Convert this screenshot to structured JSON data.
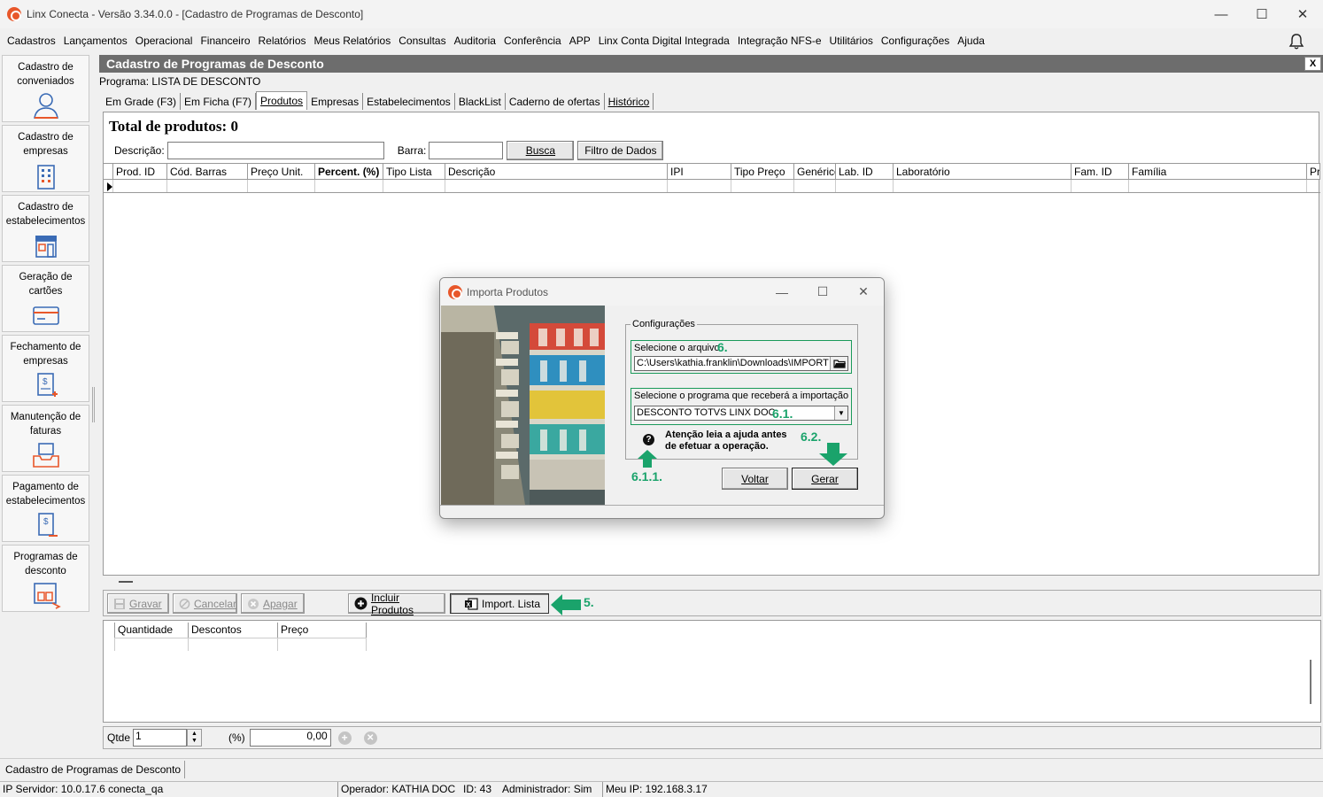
{
  "window": {
    "title": "Linx Conecta - Versão 3.34.0.0 - [Cadastro de Programas de Desconto]",
    "minimize": "—",
    "maximize": "☐",
    "close": "✕"
  },
  "menu": [
    "Cadastros",
    "Lançamentos",
    "Operacional",
    "Financeiro",
    "Relatórios",
    "Meus Relatórios",
    "Consultas",
    "Auditoria",
    "Conferência",
    "APP",
    "Linx Conta Digital Integrada",
    "Integração NFS-e",
    "Utilitários",
    "Configurações",
    "Ajuda"
  ],
  "sidebar": [
    {
      "label": "Cadastro de conveniados",
      "icon": "person-icon"
    },
    {
      "label": "Cadastro de empresas",
      "icon": "building-icon"
    },
    {
      "label": "Cadastro de estabelecimentos",
      "icon": "store-icon"
    },
    {
      "label": "Geração de cartões",
      "icon": "card-icon"
    },
    {
      "label": "Fechamento de empresas",
      "icon": "invoice-dollar-icon"
    },
    {
      "label": "Manutenção de faturas",
      "icon": "tray-icon"
    },
    {
      "label": "Pagamento de estabelecimentos",
      "icon": "payment-dollar-icon"
    },
    {
      "label": "Programas de desconto",
      "icon": "discount-program-icon"
    }
  ],
  "main": {
    "header": "Cadastro de Programas de Desconto",
    "close": "X",
    "programa": "Programa: LISTA DE DESCONTO",
    "tabs": [
      "Em Grade (F3)",
      "Em Ficha (F7)",
      "Produtos",
      "Empresas",
      "Estabelecimentos",
      "BlackList",
      "Caderno de ofertas",
      "Histórico"
    ],
    "active_tab": "Produtos",
    "total": "Total de produtos: 0",
    "descricao_label": "Descrição:",
    "barra_label": "Barra:",
    "busca": "Busca",
    "filtro": "Filtro de Dados",
    "columns": [
      "Prod. ID",
      "Cód. Barras",
      "Preço Unit.",
      "Percent. (%)",
      "Tipo Lista",
      "Descrição",
      "IPI",
      "Tipo Preço",
      "Genérico",
      "Lab. ID",
      "Laboratório",
      "Fam. ID",
      "Família",
      "Pr"
    ]
  },
  "toolbar": {
    "gravar": "Gravar",
    "cancelar": "Cancelar",
    "apagar": "Apagar",
    "incluir": "Incluir Produtos",
    "import": "Import. Lista"
  },
  "lower_grid": {
    "columns": [
      "Quantidade",
      "Descontos",
      "Preço"
    ]
  },
  "qty": {
    "qtde_label": "Qtde",
    "qtde_value": "1",
    "pct_label": "(%)",
    "pct_value": "0,00"
  },
  "taskbar": {
    "item": "Cadastro de Programas de Desconto"
  },
  "status": {
    "servidor": "IP Servidor: 10.0.17.6 conecta_qa",
    "operador": "Operador: KATHIA DOC",
    "id": "ID: 43",
    "admin": "Administrador: Sim",
    "meu_ip": "Meu IP: 192.168.3.17"
  },
  "modal": {
    "title": "Importa Produtos",
    "config_legend": "Configurações",
    "file_label": "Selecione o arquivo",
    "file_value": "C:\\Users\\kathia.franklin\\Downloads\\IMPORT",
    "program_label": "Selecione o programa que receberá a importação",
    "program_value": "DESCONTO TOTVS LINX DOC",
    "attention_line1": "Atenção leia a ajuda antes",
    "attention_line2": "de efetuar a operação.",
    "voltar": "Voltar",
    "gerar": "Gerar"
  },
  "annotations": {
    "a5": "5.",
    "a6": "6.",
    "a61": "6.1.",
    "a611": "6.1.1.",
    "a62": "6.2."
  },
  "colors": {
    "header_bg": "#6d6d6d",
    "annotation_green": "#1aa36b",
    "brand_orange": "#e8572a"
  }
}
